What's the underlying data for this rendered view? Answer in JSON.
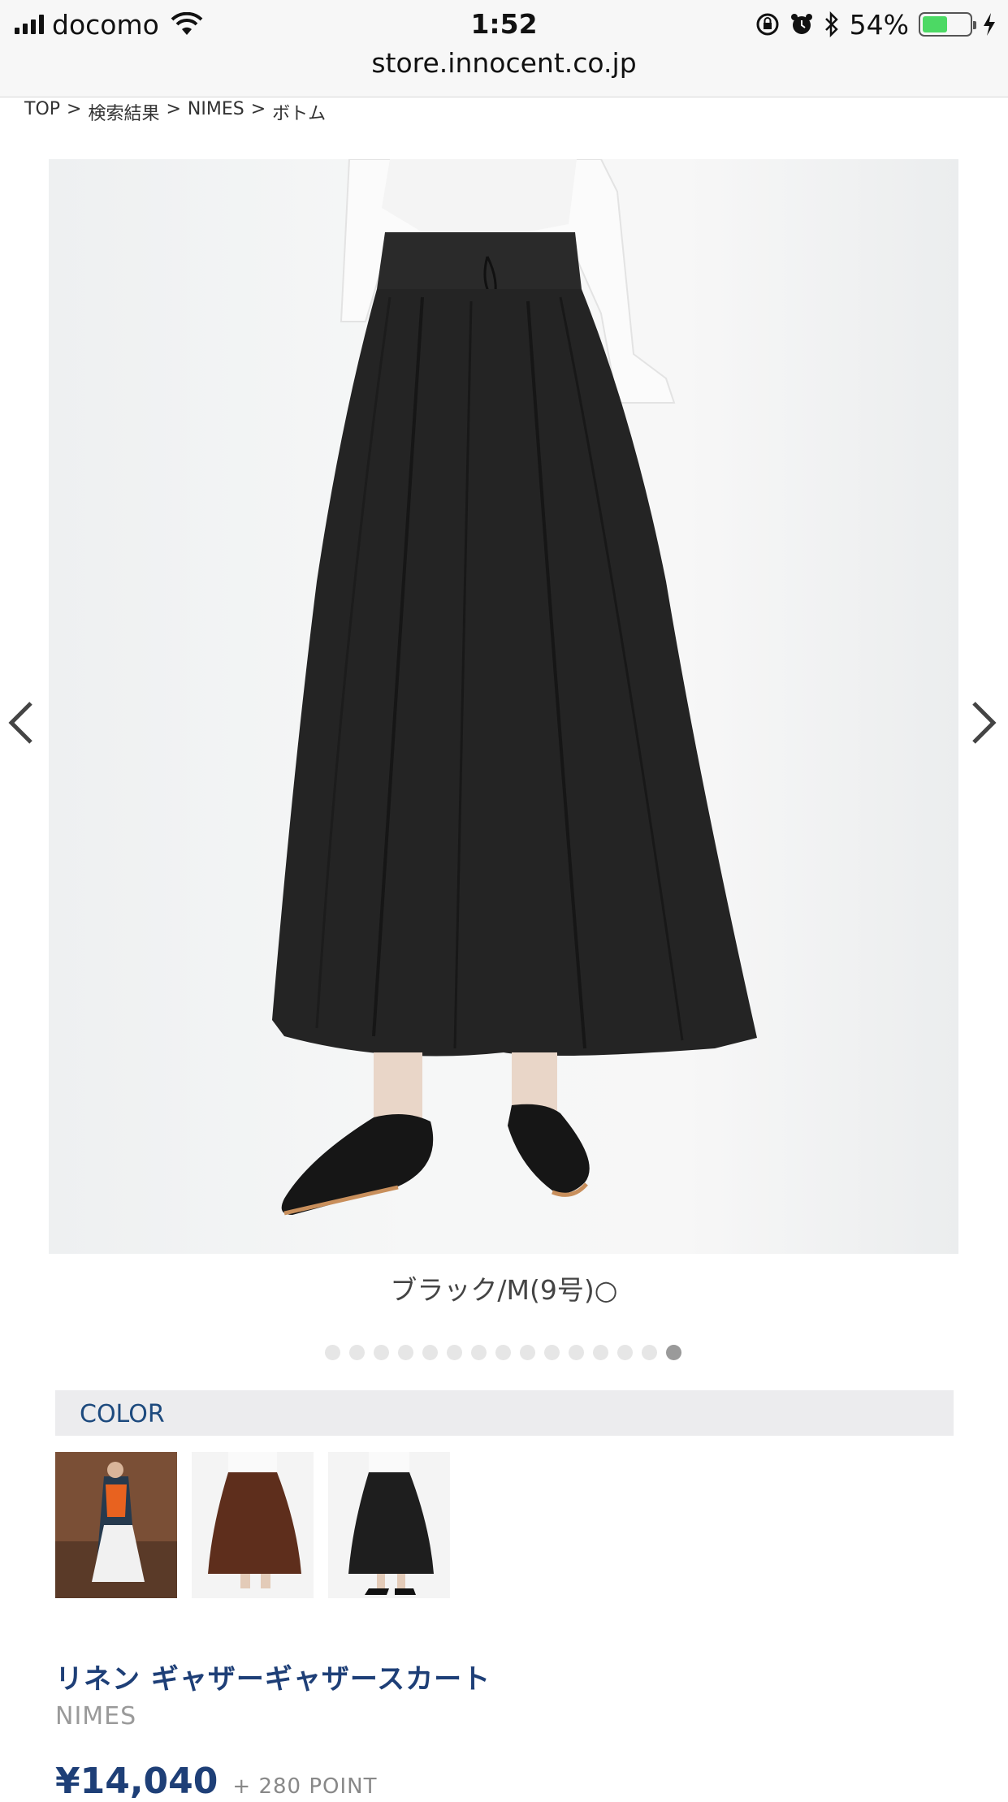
{
  "status_bar": {
    "carrier": "docomo",
    "time": "1:52",
    "battery_percent": "54%",
    "battery_level": 0.54
  },
  "browser": {
    "url": "store.innocent.co.jp"
  },
  "breadcrumb": [
    {
      "label": "TOP"
    },
    {
      "label": "検索結果"
    },
    {
      "label": "NIMES"
    },
    {
      "label": "ボトム"
    }
  ],
  "breadcrumb_separator": ">",
  "carousel": {
    "caption": "ブラック/M(9号)○",
    "dot_count": 15,
    "active_dot": 14
  },
  "color_section": {
    "label": "COLOR"
  },
  "swatches": [
    {
      "name": "model-outfit"
    },
    {
      "name": "brown"
    },
    {
      "name": "black"
    }
  ],
  "product": {
    "title": "リネン ギャザーギャザースカート",
    "brand": "NIMES",
    "price": "¥14,040",
    "points": "+ 280 POINT"
  },
  "colors": {
    "accent_navy": "#1e3f77",
    "battery_green": "#4cd964"
  }
}
